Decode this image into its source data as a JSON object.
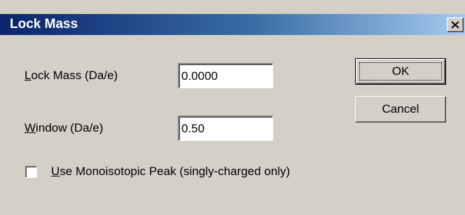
{
  "window": {
    "title": "Lock Mass",
    "close_icon": "close-icon"
  },
  "fields": {
    "lock_mass": {
      "label_accel": "L",
      "label_rest": "ock Mass (Da/e)",
      "value": "0.0000"
    },
    "window": {
      "label_accel": "W",
      "label_rest": "indow (Da/e)",
      "value": "0.50"
    }
  },
  "checkbox": {
    "label_accel": "U",
    "label_rest": "se Monoisotopic Peak (singly-charged only)",
    "checked": false
  },
  "buttons": {
    "ok_label": "OK",
    "cancel_label": "Cancel"
  },
  "colors": {
    "dialog_face": "#d4d0c8",
    "title_gradient_start": "#0a246a",
    "title_gradient_end": "#a6caf0",
    "title_text": "#ffffff"
  }
}
